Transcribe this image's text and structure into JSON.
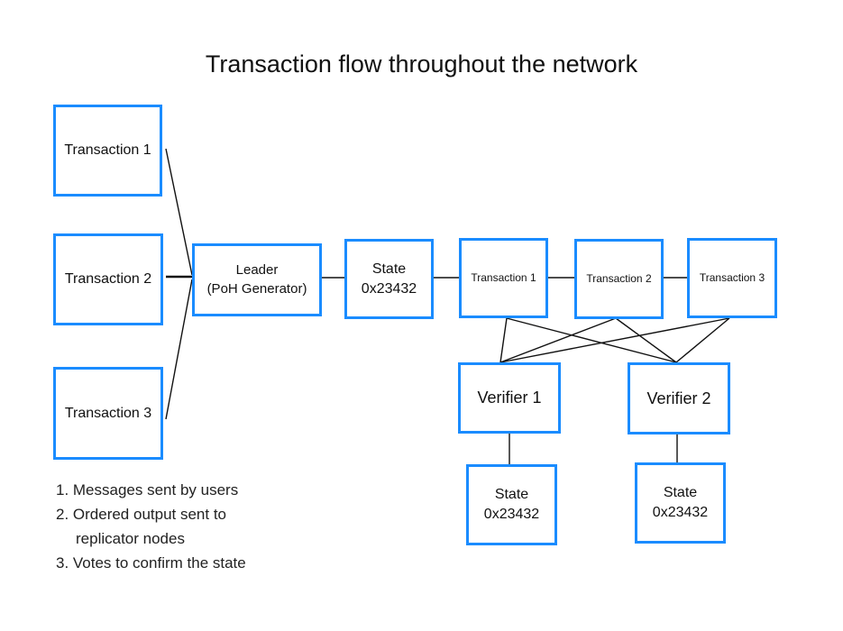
{
  "title": "Transaction flow throughout the network",
  "colors": {
    "box_border": "#1a8cff",
    "line": "#111111"
  },
  "inputs": [
    {
      "label": "Transaction 1"
    },
    {
      "label": "Transaction 2"
    },
    {
      "label": "Transaction 3"
    }
  ],
  "leader": {
    "line1": "Leader",
    "line2": "(PoH Generator)"
  },
  "state": {
    "line1": "State",
    "line2": "0x23432"
  },
  "chain": [
    {
      "label": "Transaction 1"
    },
    {
      "label": "Transaction 2"
    },
    {
      "label": "Transaction 3"
    }
  ],
  "verifiers": [
    {
      "label": "Verifier 1",
      "state_line1": "State",
      "state_line2": "0x23432"
    },
    {
      "label": "Verifier 2",
      "state_line1": "State",
      "state_line2": "0x23432"
    }
  ],
  "notes": [
    "1. Messages sent by users",
    "2. Ordered output sent to",
    "replicator nodes",
    "3. Votes to confirm the state"
  ]
}
